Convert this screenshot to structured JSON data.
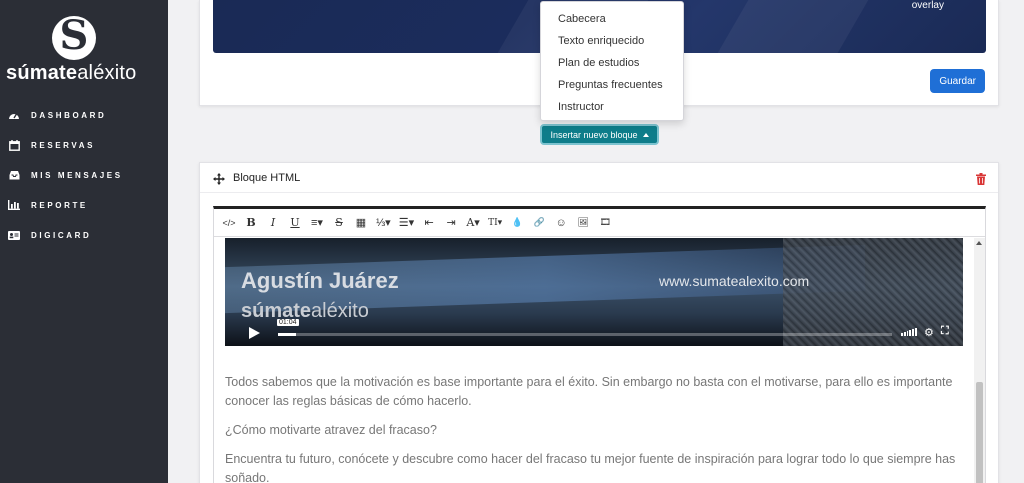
{
  "sidebar": {
    "brand_bold": "súmate",
    "brand_light": "aléxito",
    "logo_letter": "S",
    "items": [
      {
        "label": "DASHBOARD",
        "icon": "dashboard-icon"
      },
      {
        "label": "RESERVAS",
        "icon": "calendar-icon"
      },
      {
        "label": "MIS MENSAJES",
        "icon": "inbox-icon"
      },
      {
        "label": "REPORTE",
        "icon": "chart-icon"
      },
      {
        "label": "DIGICARD",
        "icon": "id-card-icon"
      }
    ]
  },
  "top_card": {
    "banner_text": "overlay",
    "save_label": "Guardar"
  },
  "dropdown": {
    "items": [
      "Cabecera",
      "Texto enriquecido",
      "Plan de estudios",
      "Preguntas frecuentes",
      "Instructor"
    ]
  },
  "insert_button": {
    "label": "Insertar nuevo bloque"
  },
  "block": {
    "title": "Bloque HTML",
    "toolbar": [
      {
        "name": "code-view-icon",
        "glyph": "</>"
      },
      {
        "name": "bold-icon",
        "glyph": "B"
      },
      {
        "name": "italic-icon",
        "glyph": "I"
      },
      {
        "name": "underline-icon",
        "glyph": "U"
      },
      {
        "name": "align-icon",
        "glyph": "≡▾"
      },
      {
        "name": "strikethrough-icon",
        "glyph": "S"
      },
      {
        "name": "table-icon",
        "glyph": "▦"
      },
      {
        "name": "ordered-list-icon",
        "glyph": "⅓▾"
      },
      {
        "name": "unordered-list-icon",
        "glyph": "☰▾"
      },
      {
        "name": "outdent-icon",
        "glyph": "⇤"
      },
      {
        "name": "indent-icon",
        "glyph": "⇥"
      },
      {
        "name": "font-color-icon",
        "glyph": "A▾"
      },
      {
        "name": "font-size-icon",
        "glyph": "TI▾"
      },
      {
        "name": "highlight-icon",
        "glyph": "💧"
      },
      {
        "name": "link-icon",
        "glyph": "🔗"
      },
      {
        "name": "emoji-icon",
        "glyph": "☺"
      },
      {
        "name": "image-icon",
        "glyph": "🖼"
      },
      {
        "name": "video-icon",
        "glyph": "🎞"
      }
    ],
    "video": {
      "name": "Agustín Juárez",
      "url": "www.sumatealexito.com",
      "brand_bold": "súmate",
      "brand_light": "aléxito",
      "time": "01:04",
      "progress": 0.03
    },
    "paragraphs": [
      "Todos sabemos que la motivación es base importante para el éxito. Sin embargo no basta con el motivarse, para ello es importante conocer las reglas básicas de cómo hacerlo.",
      "¿Cómo motivarte atravez del fracaso?",
      "Encuentra tu futuro, conócete y descubre como hacer del fracaso tu mejor fuente de inspiración para lograr todo lo que siempre has soñado."
    ]
  }
}
